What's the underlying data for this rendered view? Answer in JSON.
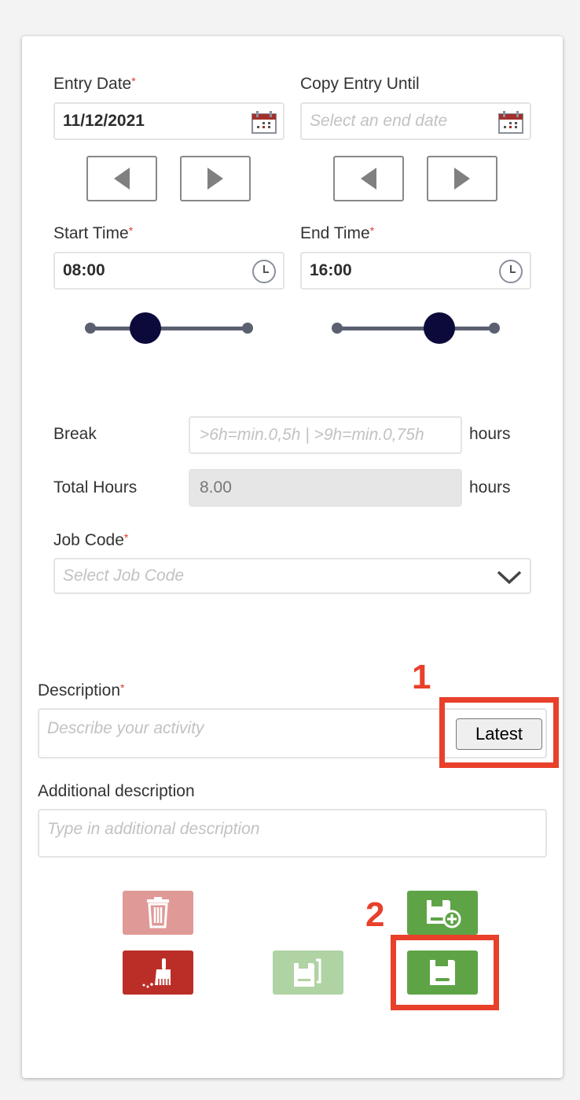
{
  "entry_date": {
    "label": "Entry Date",
    "required": "*",
    "value": "11/12/2021"
  },
  "copy_until": {
    "label": "Copy Entry Until",
    "placeholder": "Select an end date"
  },
  "start_time": {
    "label": "Start Time",
    "required": "*",
    "value": "08:00",
    "slider_fraction": 0.35
  },
  "end_time": {
    "label": "End Time",
    "required": "*",
    "value": "16:00",
    "slider_fraction": 0.65
  },
  "break": {
    "label": "Break",
    "placeholder": ">6h=min.0,5h | >9h=min.0,75h",
    "unit": "hours"
  },
  "total_hours": {
    "label": "Total Hours",
    "value": "8.00",
    "unit": "hours"
  },
  "job_code": {
    "label": "Job Code",
    "required": "*",
    "placeholder": "Select Job Code"
  },
  "description": {
    "label": "Description",
    "required": "*",
    "placeholder": "Describe your activity",
    "latest_button": "Latest"
  },
  "additional": {
    "label": "Additional description",
    "placeholder": "Type in additional description"
  },
  "annotations": {
    "one": "1",
    "two": "2"
  },
  "colors": {
    "danger_light": "#df9a97",
    "danger": "#bb2e27",
    "success": "#5ea446",
    "success_light": "#b0d3a4",
    "annotation": "#e8402a"
  }
}
